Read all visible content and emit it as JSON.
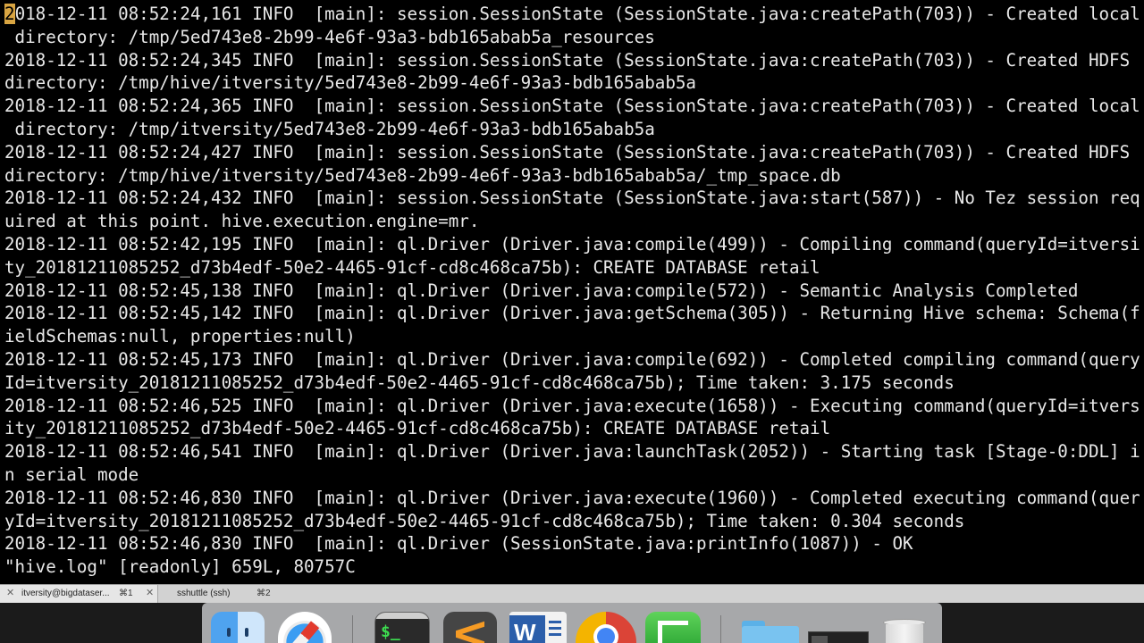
{
  "terminal": {
    "lines": [
      "2018-12-11 08:52:24,161 INFO  [main]: session.SessionState (SessionState.java:createPath(703)) - Created local",
      " directory: /tmp/5ed743e8-2b99-4e6f-93a3-bdb165abab5a_resources",
      "2018-12-11 08:52:24,345 INFO  [main]: session.SessionState (SessionState.java:createPath(703)) - Created HDFS",
      "directory: /tmp/hive/itversity/5ed743e8-2b99-4e6f-93a3-bdb165abab5a",
      "2018-12-11 08:52:24,365 INFO  [main]: session.SessionState (SessionState.java:createPath(703)) - Created local",
      " directory: /tmp/itversity/5ed743e8-2b99-4e6f-93a3-bdb165abab5a",
      "2018-12-11 08:52:24,427 INFO  [main]: session.SessionState (SessionState.java:createPath(703)) - Created HDFS",
      "directory: /tmp/hive/itversity/5ed743e8-2b99-4e6f-93a3-bdb165abab5a/_tmp_space.db",
      "2018-12-11 08:52:24,432 INFO  [main]: session.SessionState (SessionState.java:start(587)) - No Tez session req",
      "uired at this point. hive.execution.engine=mr.",
      "2018-12-11 08:52:42,195 INFO  [main]: ql.Driver (Driver.java:compile(499)) - Compiling command(queryId=itversi",
      "ty_20181211085252_d73b4edf-50e2-4465-91cf-cd8c468ca75b): CREATE DATABASE retail",
      "2018-12-11 08:52:45,138 INFO  [main]: ql.Driver (Driver.java:compile(572)) - Semantic Analysis Completed",
      "2018-12-11 08:52:45,142 INFO  [main]: ql.Driver (Driver.java:getSchema(305)) - Returning Hive schema: Schema(f",
      "ieldSchemas:null, properties:null)",
      "2018-12-11 08:52:45,173 INFO  [main]: ql.Driver (Driver.java:compile(692)) - Completed compiling command(query",
      "Id=itversity_20181211085252_d73b4edf-50e2-4465-91cf-cd8c468ca75b); Time taken: 3.175 seconds",
      "2018-12-11 08:52:46,525 INFO  [main]: ql.Driver (Driver.java:execute(1658)) - Executing command(queryId=itvers",
      "ity_20181211085252_d73b4edf-50e2-4465-91cf-cd8c468ca75b): CREATE DATABASE retail",
      "2018-12-11 08:52:46,541 INFO  [main]: ql.Driver (Driver.java:launchTask(2052)) - Starting task [Stage-0:DDL] i",
      "n serial mode",
      "2018-12-11 08:52:46,830 INFO  [main]: ql.Driver (Driver.java:execute(1960)) - Completed executing command(quer",
      "yId=itversity_20181211085252_d73b4edf-50e2-4465-91cf-cd8c468ca75b); Time taken: 0.304 seconds",
      "2018-12-11 08:52:46,830 INFO  [main]: ql.Driver (SessionState.java:printInfo(1087)) - OK"
    ],
    "first_char": "2",
    "status_line": "\"hive.log\" [readonly] 659L, 80757C"
  },
  "tabs": [
    {
      "label": "itversity@bigdataser...",
      "shortcut": "⌘1",
      "close": "✕"
    },
    {
      "label": "sshuttle (ssh)",
      "shortcut": "⌘2",
      "close": "✕"
    }
  ],
  "dock": {
    "apps": [
      "finder-icon",
      "safari-icon",
      "terminal-icon",
      "sublime-text-icon",
      "word-icon",
      "chrome-icon",
      "numbers-icon",
      "folder-icon",
      "screenshot-icon",
      "trash-icon"
    ],
    "terminal_glyph": "$_",
    "word_glyph": "W"
  },
  "colors": {
    "terminal_bg": "#000000",
    "terminal_fg": "#e8e8e8",
    "cursor": "#d9a542"
  }
}
